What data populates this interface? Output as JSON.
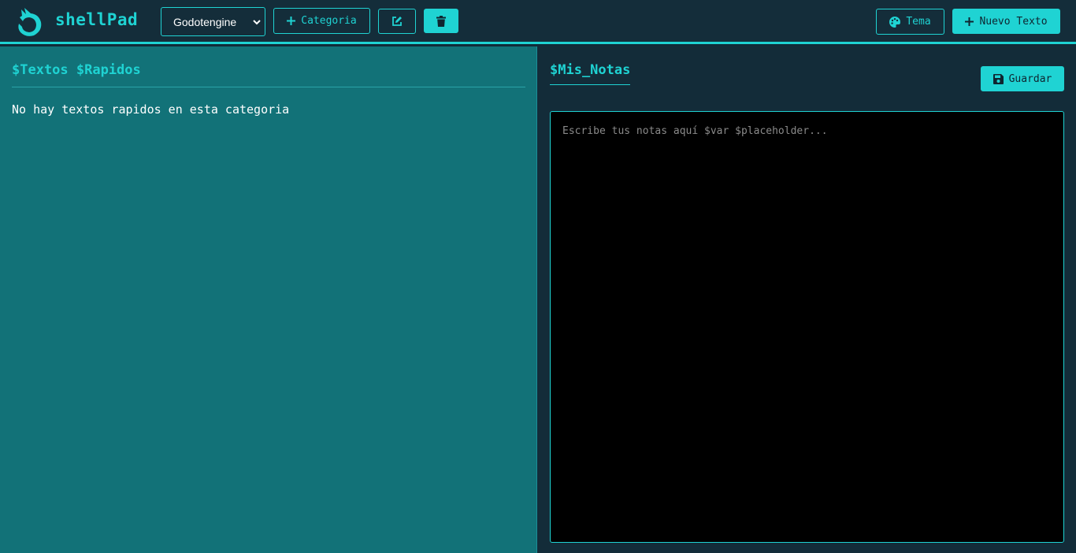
{
  "app": {
    "title": "shellPad",
    "accent": "#1fd3d3"
  },
  "header": {
    "category_select": {
      "value": "Godotengine"
    },
    "add_category_label": "Categoria",
    "theme_label": "Tema",
    "new_text_label": "Nuevo Texto",
    "icons": {
      "logo": "dragon-logo-icon",
      "add": "plus-icon",
      "edit": "pencil-square-icon",
      "delete": "trash-icon",
      "theme": "palette-icon"
    }
  },
  "quick_texts": {
    "title": "$Textos $Rapidos",
    "empty_message": "No hay textos rapidos en esta categoria"
  },
  "notes": {
    "title": "$Mis_Notas",
    "save_label": "Guardar",
    "placeholder": "Escribe tus notas aquí $var $placeholder...",
    "value": ""
  }
}
